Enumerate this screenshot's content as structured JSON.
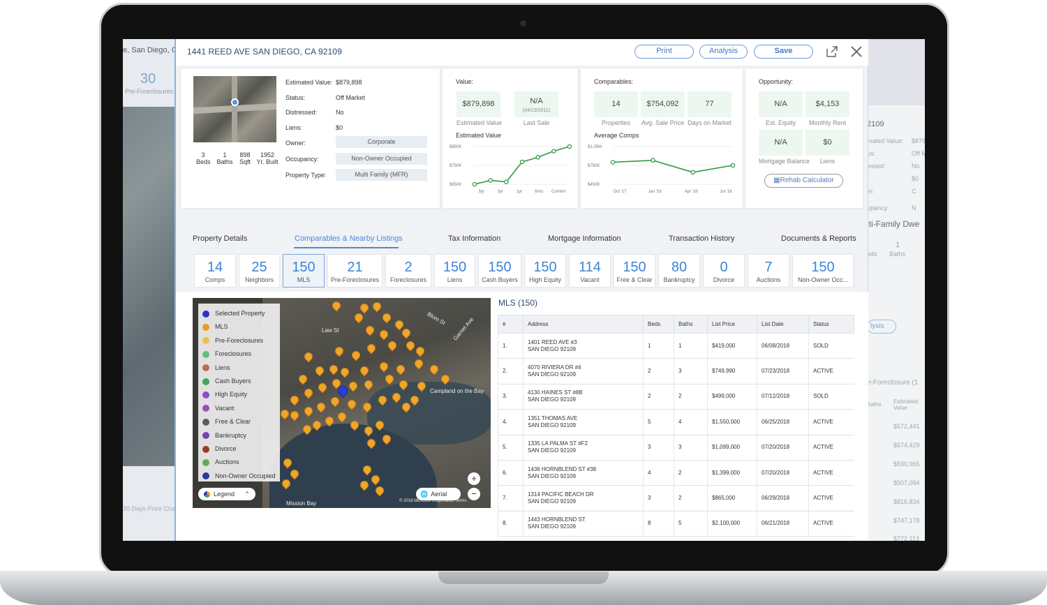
{
  "background_page": {
    "address_fragment": "e, San Diego, CA",
    "pre_count": "30",
    "pre_label": "Pre-Foreclosures",
    "price_change_fragment": "30 Days Price Cha",
    "right_zip_fragment": "2109",
    "right_lines": [
      "mated Value:",
      "us:",
      "essed:",
      "er:",
      "upancy:"
    ],
    "right_values": [
      "$879",
      "Off M",
      "No",
      "$0",
      "C",
      "N"
    ],
    "right_type_fragment": "lti-Family Dwe",
    "right_beds": "1",
    "right_baths_label": "Baths",
    "right_beds_label": "eds",
    "right_analysis": "lysis",
    "right_section": "e-Foreclosure (1",
    "right_col1": "Baths",
    "right_col2": "Estimated Value",
    "right_prices": [
      "$572,441",
      "$574,429",
      "$590,965",
      "$507,094",
      "$816,834",
      "$747,178",
      "$772,113"
    ]
  },
  "header": {
    "address": "1441 REED AVE SAN DIEGO, CA 92109",
    "print_label": "Print",
    "analysis_label": "Analysis",
    "save_label": "Save",
    "share_icon": "share-icon",
    "close_icon": "close-icon"
  },
  "property": {
    "beds": "3",
    "beds_label": "Beds",
    "baths": "1",
    "baths_label": "Baths",
    "sqft": "898",
    "sqft_label": "Sqft",
    "year": "1952",
    "year_label": "Yr. Built",
    "fields": [
      {
        "label": "Estimated Value:",
        "value": "$879,898"
      },
      {
        "label": "Status:",
        "value": "Off Market"
      },
      {
        "label": "Distressed:",
        "value": "No"
      },
      {
        "label": "Liens:",
        "value": "$0"
      },
      {
        "label": "Owner:",
        "value": "Corporate"
      },
      {
        "label": "Occupancy:",
        "value": "Non-Owner Occupied"
      },
      {
        "label": "Property Type:",
        "value": "Multi Family (MFR)"
      }
    ]
  },
  "value_card": {
    "title": "Value:",
    "est_value": "$879,898",
    "est_value_label": "Estimated Value",
    "last_sale": "N/A",
    "last_sale_date": "(04/13/2011)",
    "last_sale_label": "Last Sale",
    "chart_title": "Estimated Value"
  },
  "comparables_card": {
    "title": "Comparables:",
    "properties": "14",
    "properties_label": "Properties",
    "avg_price": "$754,092",
    "avg_price_label": "Avg. Sale Price",
    "dom": "77",
    "dom_label": "Days on Market",
    "chart_title": "Average Comps"
  },
  "opportunity_card": {
    "title": "Opportunity:",
    "equity": "N/A",
    "equity_label": "Est. Equity",
    "rent": "$4,153",
    "rent_label": "Monthly Rent",
    "mortgage": "N/A",
    "mortgage_label": "Mortgage Balance",
    "liens": "$0",
    "liens_label": "Liens",
    "rehab_label": "Rehab Calculator"
  },
  "tabs": [
    {
      "label": "Property Details"
    },
    {
      "label": "Comparables & Nearby Listings"
    },
    {
      "label": "Tax Information"
    },
    {
      "label": "Mortgage Information"
    },
    {
      "label": "Transaction History"
    },
    {
      "label": "Documents & Reports"
    }
  ],
  "counts": [
    {
      "num": "14",
      "label": "Comps"
    },
    {
      "num": "25",
      "label": "Neighbors"
    },
    {
      "num": "150",
      "label": "MLS"
    },
    {
      "num": "21",
      "label": "Pre-Foreclosures"
    },
    {
      "num": "2",
      "label": "Foreclosures"
    },
    {
      "num": "150",
      "label": "Liens"
    },
    {
      "num": "150",
      "label": "Cash Buyers"
    },
    {
      "num": "150",
      "label": "High Equity"
    },
    {
      "num": "114",
      "label": "Vacant"
    },
    {
      "num": "150",
      "label": "Free & Clear"
    },
    {
      "num": "80",
      "label": "Bankruptcy"
    },
    {
      "num": "0",
      "label": "Divorce"
    },
    {
      "num": "7",
      "label": "Auctions"
    },
    {
      "num": "150",
      "label": "Non-Owner Occ..."
    }
  ],
  "legend": [
    {
      "label": "Selected Property",
      "color": "#2a31c9"
    },
    {
      "label": "MLS",
      "color": "#e89b24"
    },
    {
      "label": "Pre-Foreclosures",
      "color": "#f2c04a"
    },
    {
      "label": "Foreclosures",
      "color": "#5fc27a"
    },
    {
      "label": "Liens",
      "color": "#c2675a"
    },
    {
      "label": "Cash Buyers",
      "color": "#3fa65a"
    },
    {
      "label": "High Equity",
      "color": "#8a4fc9"
    },
    {
      "label": "Vacant",
      "color": "#9b4fb0"
    },
    {
      "label": "Free & Clear",
      "color": "#5c5c5c"
    },
    {
      "label": "Bankruptcy",
      "color": "#7d3fb8"
    },
    {
      "label": "Divorce",
      "color": "#9a3a2c"
    },
    {
      "label": "Auctions",
      "color": "#6aa84f"
    },
    {
      "label": "Non-Owner Occupied",
      "color": "#2a3a9a"
    }
  ],
  "map": {
    "legend_label": "Legend",
    "aerial_label": "Aerial",
    "zoom_in": "+",
    "zoom_out": "−",
    "place_campland": "Campland on the Bay",
    "place_mission": "Mission Bay",
    "street_law": "Law St",
    "street_garnet": "Garnet Ave",
    "street_blom": "Blom St",
    "copyright": "© 2018 Microsoft Corporation  Terms"
  },
  "mls": {
    "title": "MLS (150)",
    "columns": [
      "#",
      "Address",
      "Beds",
      "Baths",
      "List Price",
      "List Date",
      "Status"
    ],
    "rows": [
      {
        "n": "1.",
        "a1": "1401 REED AVE #3",
        "a2": "SAN DIEGO 92109",
        "beds": "1",
        "baths": "1",
        "price": "$419,000",
        "date": "06/08/2018",
        "status": "SOLD"
      },
      {
        "n": "2.",
        "a1": "4070 RIVIERA DR #4",
        "a2": "SAN DIEGO 92109",
        "beds": "2",
        "baths": "3",
        "price": "$749,990",
        "date": "07/23/2018",
        "status": "ACTIVE"
      },
      {
        "n": "3.",
        "a1": "4130 HAINES ST #8B",
        "a2": "SAN DIEGO 92109",
        "beds": "2",
        "baths": "2",
        "price": "$499,000",
        "date": "07/12/2018",
        "status": "SOLD"
      },
      {
        "n": "4.",
        "a1": "1351 THOMAS AVE",
        "a2": "SAN DIEGO 92109",
        "beds": "5",
        "baths": "4",
        "price": "$1,550,000",
        "date": "06/25/2018",
        "status": "ACTIVE"
      },
      {
        "n": "5.",
        "a1": "1335 LA PALMA ST #F2",
        "a2": "SAN DIEGO 92109",
        "beds": "3",
        "baths": "3",
        "price": "$1,099,000",
        "date": "07/20/2018",
        "status": "ACTIVE"
      },
      {
        "n": "6.",
        "a1": "1436 HORNBLEND ST #38",
        "a2": "SAN DIEGO 92109",
        "beds": "4",
        "baths": "2",
        "price": "$1,399,000",
        "date": "07/20/2018",
        "status": "ACTIVE"
      },
      {
        "n": "7.",
        "a1": "1314 PACIFIC BEACH DR",
        "a2": "SAN DIEGO 92109",
        "beds": "3",
        "baths": "2",
        "price": "$865,000",
        "date": "06/29/2018",
        "status": "ACTIVE"
      },
      {
        "n": "8.",
        "a1": "1443 HORNBLEND ST",
        "a2": "SAN DIEGO 92109",
        "beds": "8",
        "baths": "5",
        "price": "$2,100,000",
        "date": "06/21/2018",
        "status": "ACTIVE"
      }
    ]
  },
  "chart_data": [
    {
      "type": "line",
      "title": "Estimated Value",
      "categories": [
        "5yr",
        "3yr",
        "1yr",
        "6mo",
        "Current"
      ],
      "x_positions": [
        0,
        1,
        2,
        3,
        4,
        5,
        6
      ],
      "values": [
        615,
        640,
        630,
        760,
        790,
        830,
        860
      ],
      "ytick_labels": [
        "$850K",
        "$750K",
        "$650K"
      ],
      "ylim": [
        615,
        860
      ],
      "color": "#2e9a3f"
    },
    {
      "type": "line",
      "title": "Average Comps",
      "categories": [
        "Oct '17",
        "Jan '18",
        "Apr '18",
        "Jul '18"
      ],
      "values": [
        800,
        830,
        640,
        750
      ],
      "ytick_labels": [
        "$1.05M",
        "$750K",
        "$450K"
      ],
      "ylim": [
        450,
        1050
      ],
      "color": "#2e9a3f"
    }
  ]
}
